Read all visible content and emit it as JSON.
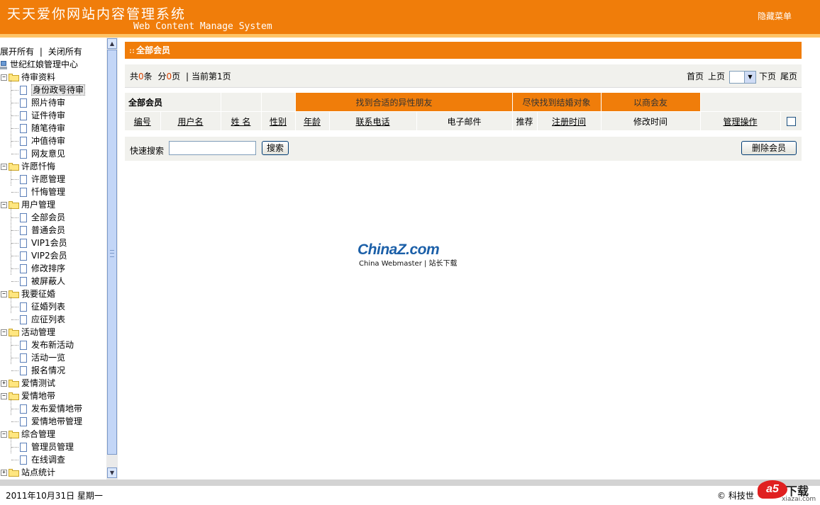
{
  "header": {
    "title_cn": "天天爱你网站内容管理系统",
    "title_en": "Web Content Manage System",
    "hide_menu": "隐藏菜单"
  },
  "sidebar": {
    "expand_all": "展开所有",
    "separator": "|",
    "collapse_all": "关闭所有",
    "root": "世纪红娘管理中心",
    "groups": [
      {
        "label": "待审资料",
        "expanded": true,
        "items": [
          "身份政号待审",
          "照片待审",
          "证件待审",
          "随笔待审",
          "冲值待审",
          "网友意见"
        ]
      },
      {
        "label": "许愿忏悔",
        "expanded": true,
        "items": [
          "许愿管理",
          "忏悔管理"
        ]
      },
      {
        "label": "用户管理",
        "expanded": true,
        "items": [
          "全部会员",
          "普通会员",
          "VIP1会员",
          "VIP2会员",
          "修改排序",
          "被屏蔽人"
        ]
      },
      {
        "label": "我要征婚",
        "expanded": true,
        "items": [
          "征婚列表",
          "应征列表"
        ]
      },
      {
        "label": "活动管理",
        "expanded": true,
        "items": [
          "发布新活动",
          "活动一览",
          "报名情况"
        ]
      },
      {
        "label": "爱情测试",
        "expanded": false,
        "items": []
      },
      {
        "label": "爱情地带",
        "expanded": true,
        "items": [
          "发布爱情地带",
          "爱情地带管理"
        ]
      },
      {
        "label": "综合管理",
        "expanded": true,
        "items": [
          "管理员管理",
          "在线调查"
        ]
      },
      {
        "label": "站点统计",
        "expanded": false,
        "items": []
      }
    ],
    "active_item": "身份政号待审"
  },
  "main": {
    "panel_title_deco": "::",
    "panel_title": "全部会员",
    "pager": {
      "total_prefix": "共",
      "total_count": "0",
      "total_unit": "条",
      "pages_prefix": "分",
      "pages_count": "0",
      "pages_unit": "页",
      "sep": "|",
      "current": "当前第1页",
      "first": "首页",
      "prev": "上页",
      "next": "下页",
      "last": "尾页"
    },
    "table": {
      "title": "全部会员",
      "filters": [
        "找到合适的异性朋友",
        "尽快找到结婚对象",
        "以商会友"
      ],
      "columns": [
        "编号",
        "用户名",
        "姓 名",
        "性别",
        "年龄",
        "联系电话",
        "电子邮件",
        "推荐",
        "注册时间",
        "修改时间",
        "管理操作"
      ]
    },
    "search": {
      "label": "快速搜索",
      "value": "",
      "button": "搜索"
    },
    "delete_button": "删除会员",
    "watermark": {
      "china": "China",
      "z": "Z",
      "com": ".com",
      "sub": "China Webmaster | 站长下载"
    }
  },
  "footer": {
    "date": "2011年10月31日  星期一",
    "copyright": "© 科技世"
  },
  "logo": {
    "a5": "a5",
    "download": "下载",
    "site": "xiazai.com"
  },
  "colors": {
    "accent_orange": "#f07d0a",
    "highlight_strip": "#ffc466",
    "table_bg": "#f1f1ed",
    "count_red": "#d64000"
  }
}
